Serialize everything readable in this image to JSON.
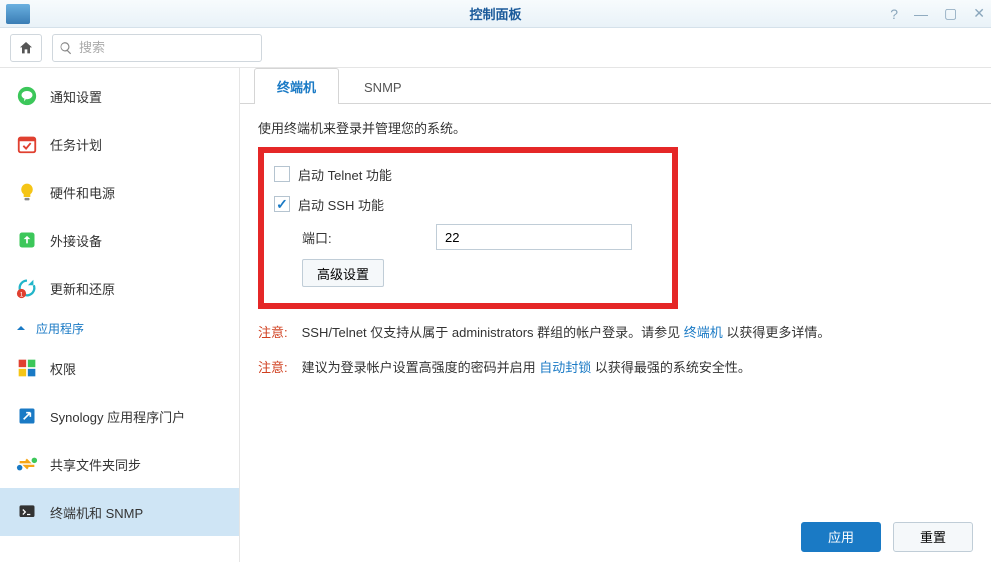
{
  "window": {
    "title": "控制面板"
  },
  "search": {
    "placeholder": "搜索"
  },
  "sidebar": {
    "items": [
      {
        "label": "通知设置"
      },
      {
        "label": "任务计划"
      },
      {
        "label": "硬件和电源"
      },
      {
        "label": "外接设备"
      },
      {
        "label": "更新和还原"
      }
    ],
    "section_label": "应用程序",
    "apps": [
      {
        "label": "权限"
      },
      {
        "label": "Synology 应用程序门户"
      },
      {
        "label": "共享文件夹同步"
      },
      {
        "label": "终端机和 SNMP"
      }
    ]
  },
  "tabs": {
    "terminal": "终端机",
    "snmp": "SNMP"
  },
  "panel": {
    "desc": "使用终端机来登录并管理您的系统。",
    "telnet_label": "启动 Telnet 功能",
    "ssh_label": "启动 SSH 功能",
    "port_label": "端口:",
    "port_value": "22",
    "adv_btn": "高级设置",
    "note_label": "注意:",
    "note1a": "SSH/Telnet 仅支持从属于 administrators 群组的帐户登录。请参见 ",
    "note1_link": "终端机",
    "note1b": " 以获得更多详情。",
    "note2a": "建议为登录帐户设置高强度的密码并启用 ",
    "note2_link": "自动封锁",
    "note2b": " 以获得最强的系统安全性。"
  },
  "footer": {
    "apply": "应用",
    "reset": "重置"
  }
}
